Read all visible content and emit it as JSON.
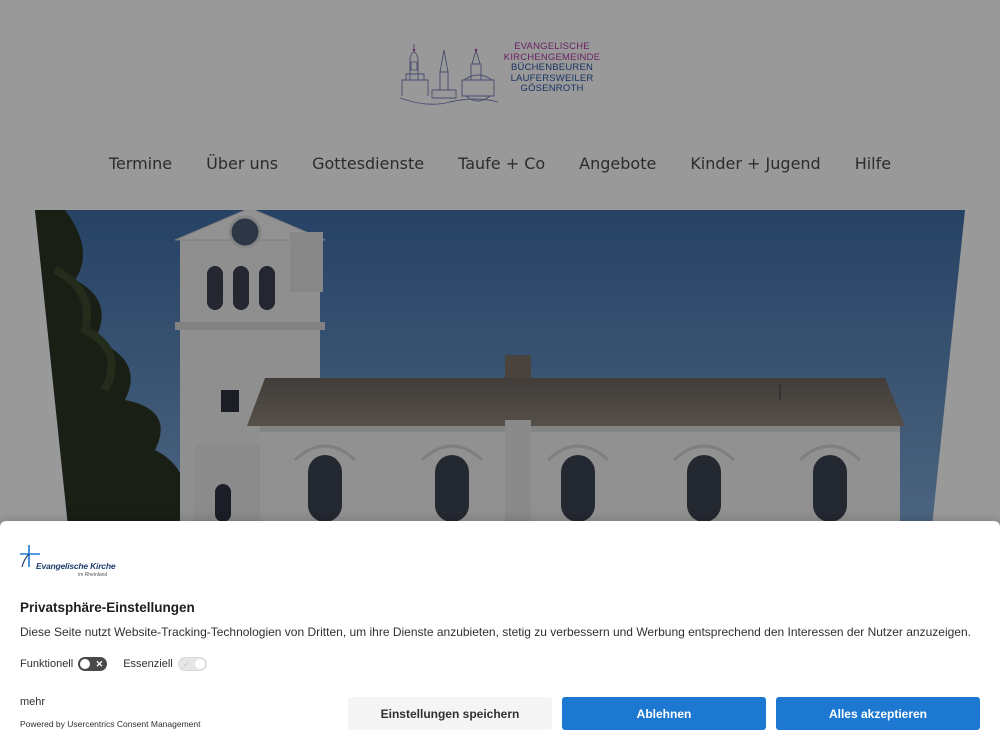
{
  "logo": {
    "lines": [
      {
        "text": "EVANGELISCHE",
        "color": "#b03aa6"
      },
      {
        "text": "KIRCHENGEMEINDE",
        "color": "#b03aa6"
      },
      {
        "text": "BÜCHENBEUREN",
        "color": "#2b54a7"
      },
      {
        "text": "LAUFERSWEILER",
        "color": "#2b54a7"
      },
      {
        "text": "GÖSENROTH",
        "color": "#2b54a7"
      }
    ]
  },
  "nav": {
    "items": [
      "Termine",
      "Über uns",
      "Gottesdienste",
      "Taufe + Co",
      "Angebote",
      "Kinder + Jugend",
      "Hilfe"
    ]
  },
  "consent": {
    "brand_name": "Evangelische Kirche",
    "brand_sub": "im Rheinland",
    "title": "Privatsphäre-Einstellungen",
    "description": "Diese Seite nutzt Website-Tracking-Technologien von Dritten, um ihre Dienste anzubieten, stetig zu verbessern und Werbung entsprechend den Interessen der Nutzer anzuzeigen.",
    "toggles": [
      {
        "label": "Funktionell",
        "state": "off"
      },
      {
        "label": "Essenziell",
        "state": "on-disabled"
      }
    ],
    "more_label": "mehr",
    "powered_by": "Powered by Usercentrics Consent Management",
    "buttons": {
      "save": "Einstellungen speichern",
      "deny": "Ablehnen",
      "accept": "Alles akzeptieren"
    },
    "accent_color": "#1c78d0"
  }
}
